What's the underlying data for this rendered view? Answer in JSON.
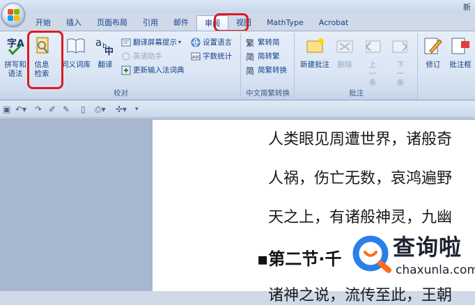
{
  "window": {
    "title": "新"
  },
  "tabs": [
    "开始",
    "插入",
    "页面布局",
    "引用",
    "邮件",
    "审阅",
    "视图",
    "MathType",
    "Acrobat"
  ],
  "active_tab": "审阅",
  "ribbon": {
    "proofing": {
      "label": "校对",
      "spelling": "拼写和语法",
      "research": "信息检索",
      "thesaurus": "同义词库",
      "translate": "翻译",
      "translate_tip": "翻译屏幕提示",
      "ime_helper": "英语助手",
      "update_ime": "更新输入法词典",
      "set_language": "设置语言",
      "word_count": "字数统计"
    },
    "chinese": {
      "label": "中文简繁转换",
      "to_simplified": "繁转简",
      "to_traditional": "简转繁",
      "convert": "简繁转换"
    },
    "comments": {
      "label": "批注",
      "new": "新建批注",
      "delete": "删除",
      "prev": "上一条",
      "next": "下一条"
    },
    "tracking": {
      "revise": "修订",
      "balloons": "批注框"
    }
  },
  "document": {
    "lines": [
      "人类眼见周遭世界，诸般奇",
      "人祸，伤亡无数，哀鸿遍野",
      "天之上，有诸般神灵，九幽"
    ],
    "heading": "▪第二节·千",
    "last_line": "诸神之说，流传至此，王朝"
  },
  "watermark": {
    "title": "查询啦",
    "url": "chaxunla.com"
  },
  "colors": {
    "highlight": "#e0191f",
    "ribbon_text": "#15428b"
  }
}
